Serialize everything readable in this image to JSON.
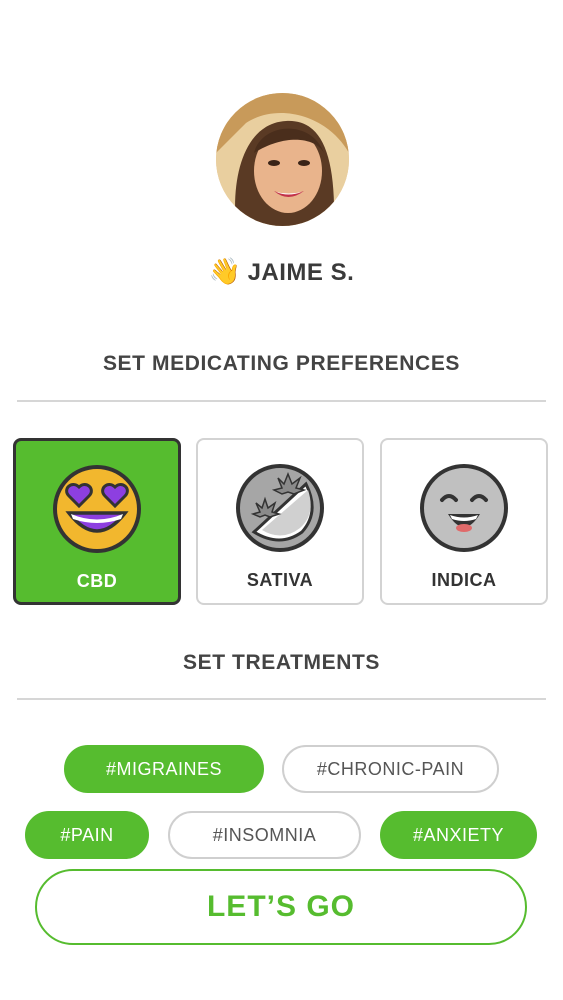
{
  "profile": {
    "name": "JAIME S.",
    "wave_emoji": "👋"
  },
  "preferences": {
    "title": "SET MEDICATING PREFERENCES",
    "options": [
      {
        "label": "CBD",
        "icon": "heart-eyes-face-icon",
        "selected": true
      },
      {
        "label": "SATIVA",
        "icon": "leaf-half-face-icon",
        "selected": false
      },
      {
        "label": "INDICA",
        "icon": "grinning-face-icon",
        "selected": false
      }
    ]
  },
  "treatments": {
    "title": "SET TREATMENTS",
    "tags": [
      {
        "label": "#MIGRAINES",
        "active": true
      },
      {
        "label": "#CHRONIC-PAIN",
        "active": false
      },
      {
        "label": "#PAIN",
        "active": true
      },
      {
        "label": "#INSOMNIA",
        "active": false
      },
      {
        "label": "#ANXIETY",
        "active": true
      }
    ]
  },
  "cta": {
    "label": "LET’S GO"
  },
  "colors": {
    "accent": "#56bc2f",
    "text": "#333333",
    "divider": "#d6d6d6"
  }
}
